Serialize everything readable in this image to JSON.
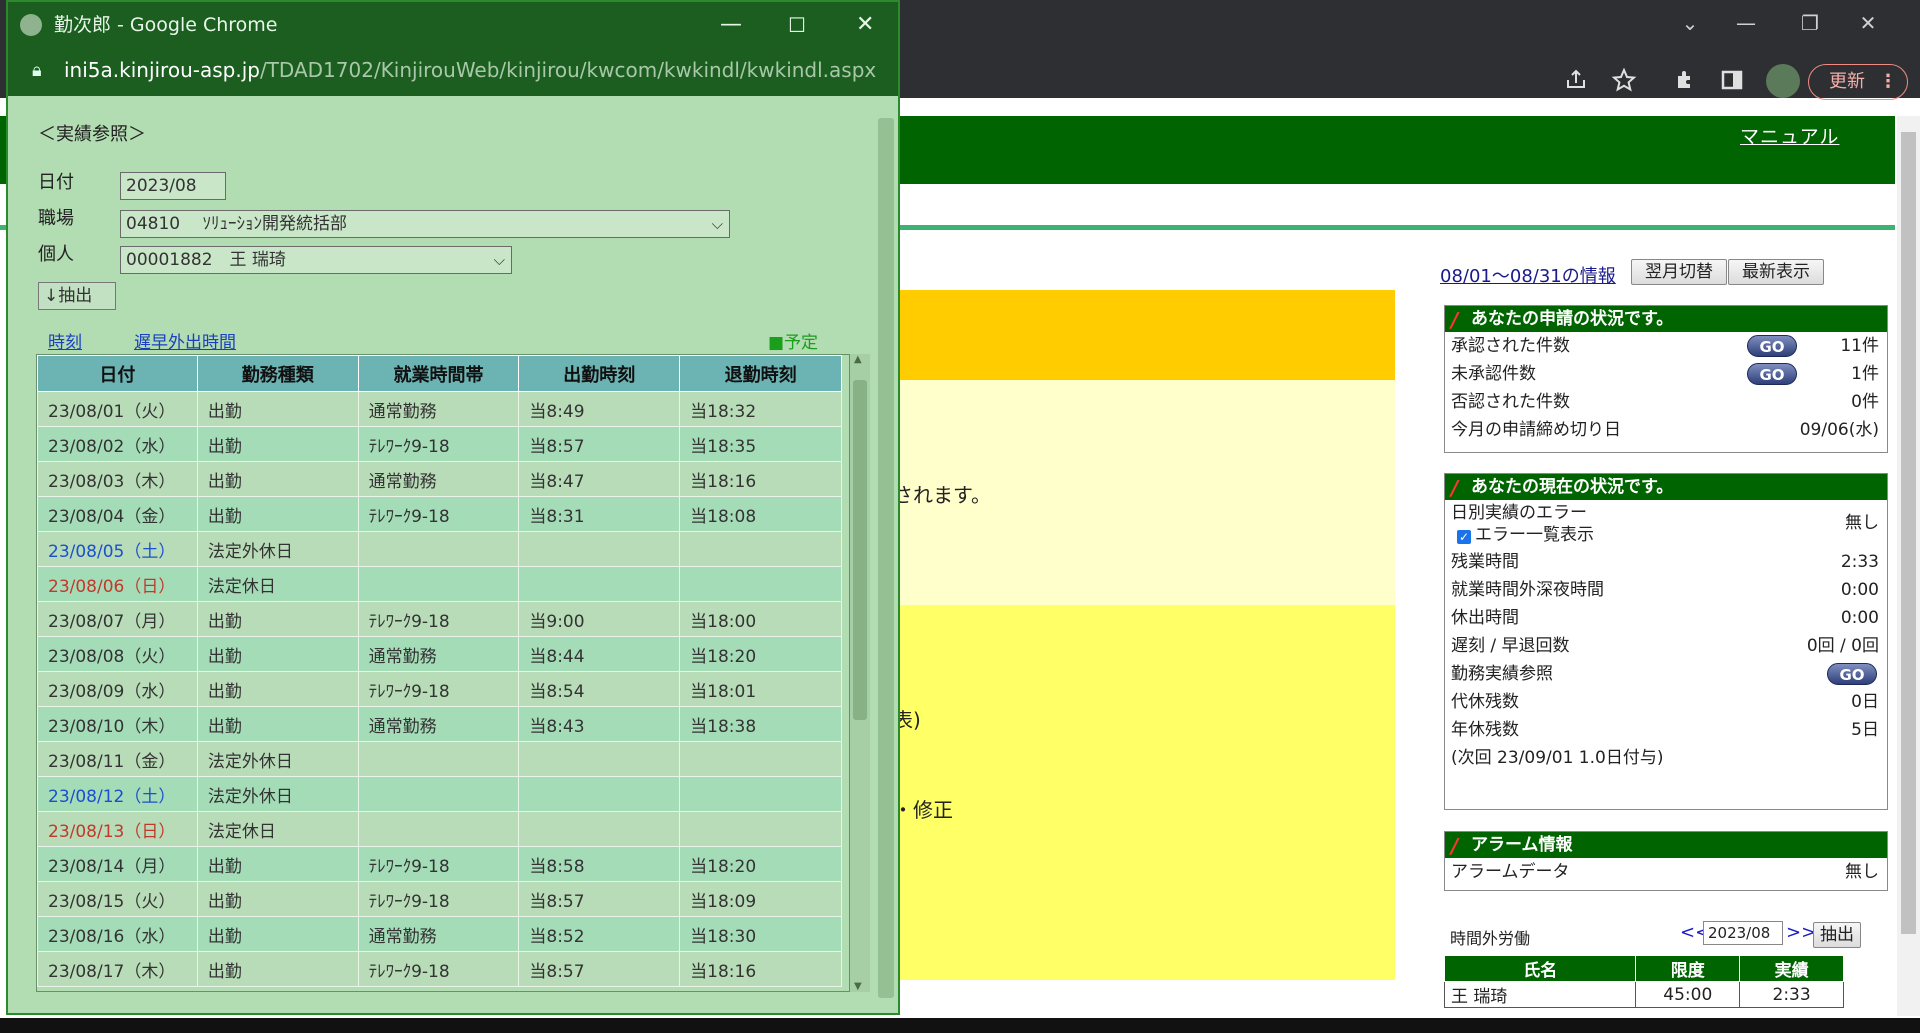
{
  "popup": {
    "window_title": "勤次郎 - Google Chrome",
    "url_host": "ini5a.kinjirou-asp.jp",
    "url_path": "/TDAD1702/KinjirouWeb/kinjirou/kwcom/kwkindl/kwkindl.aspx",
    "heading": "＜実績参照＞",
    "date_label": "日付",
    "date_value": "2023/08",
    "workplace_label": "職場",
    "workplace_value": "04810　 ｿﾘｭｰｼｮﾝ開発統括部",
    "person_label": "個人",
    "person_value": "00001882　王 瑞琦",
    "extract_button": "↓抽出",
    "link_time": "時刻",
    "link_late": "遅早外出時間",
    "legend": "■予定",
    "columns": [
      "日付",
      "勤務種類",
      "就業時間帯",
      "出勤時刻",
      "退勤時刻"
    ],
    "rows": [
      {
        "date": "23/08/01（火）",
        "type": "出勤",
        "band": "通常勤務",
        "in": "当8:49",
        "out": "当18:32",
        "day": ""
      },
      {
        "date": "23/08/02（水）",
        "type": "出勤",
        "band": "ﾃﾚﾜｰｸ9-18",
        "in": "当8:57",
        "out": "当18:35",
        "day": ""
      },
      {
        "date": "23/08/03（木）",
        "type": "出勤",
        "band": "通常勤務",
        "in": "当8:47",
        "out": "当18:16",
        "day": ""
      },
      {
        "date": "23/08/04（金）",
        "type": "出勤",
        "band": "ﾃﾚﾜｰｸ9-18",
        "in": "当8:31",
        "out": "当18:08",
        "day": ""
      },
      {
        "date": "23/08/05（土）",
        "type": "法定外休日",
        "band": "",
        "in": "",
        "out": "",
        "day": "sat"
      },
      {
        "date": "23/08/06（日）",
        "type": "法定休日",
        "band": "",
        "in": "",
        "out": "",
        "day": "sun"
      },
      {
        "date": "23/08/07（月）",
        "type": "出勤",
        "band": "ﾃﾚﾜｰｸ9-18",
        "in": "当9:00",
        "out": "当18:00",
        "day": ""
      },
      {
        "date": "23/08/08（火）",
        "type": "出勤",
        "band": "通常勤務",
        "in": "当8:44",
        "out": "当18:20",
        "day": ""
      },
      {
        "date": "23/08/09（水）",
        "type": "出勤",
        "band": "ﾃﾚﾜｰｸ9-18",
        "in": "当8:54",
        "out": "当18:01",
        "day": ""
      },
      {
        "date": "23/08/10（木）",
        "type": "出勤",
        "band": "通常勤務",
        "in": "当8:43",
        "out": "当18:38",
        "day": ""
      },
      {
        "date": "23/08/11（金）",
        "type": "法定外休日",
        "band": "",
        "in": "",
        "out": "",
        "day": ""
      },
      {
        "date": "23/08/12（土）",
        "type": "法定外休日",
        "band": "",
        "in": "",
        "out": "",
        "day": "sat"
      },
      {
        "date": "23/08/13（日）",
        "type": "法定休日",
        "band": "",
        "in": "",
        "out": "",
        "day": "sun"
      },
      {
        "date": "23/08/14（月）",
        "type": "出勤",
        "band": "ﾃﾚﾜｰｸ9-18",
        "in": "当8:58",
        "out": "当18:20",
        "day": ""
      },
      {
        "date": "23/08/15（火）",
        "type": "出勤",
        "band": "ﾃﾚﾜｰｸ9-18",
        "in": "当8:57",
        "out": "当18:09",
        "day": ""
      },
      {
        "date": "23/08/16（水）",
        "type": "出勤",
        "band": "通常勤務",
        "in": "当8:52",
        "out": "当18:30",
        "day": ""
      },
      {
        "date": "23/08/17（木）",
        "type": "出勤",
        "band": "ﾃﾚﾜｰｸ9-18",
        "in": "当8:57",
        "out": "当18:16",
        "day": ""
      }
    ]
  },
  "browser": {
    "update_button": "更新"
  },
  "page": {
    "manual_link": "マニュアル",
    "fragment_1": "されます。",
    "fragment_2": "表)",
    "fragment_3": "・修正",
    "period_link": "08/01～08/31の情報",
    "next_month_button": "翌月切替",
    "refresh_button": "最新表示",
    "requests": {
      "title": "あなたの申請の状況です。",
      "approved_label": "承認された件数",
      "approved_value": "11件",
      "pending_label": "未承認件数",
      "pending_value": "1件",
      "rejected_label": "否認された件数",
      "rejected_value": "0件",
      "deadline_label": "今月の申請締め切り日",
      "deadline_value": "09/06(水)",
      "go": "GO"
    },
    "status": {
      "title": "あなたの現在の状況です。",
      "error_label": "日別実績のエラー",
      "error_value": "無し",
      "error_list_label": "エラー一覧表示",
      "overtime_label": "残業時間",
      "overtime_value": "2:33",
      "night_label": "就業時間外深夜時間",
      "night_value": "0:00",
      "holiday_label": "休出時間",
      "holiday_value": "0:00",
      "late_label": "遅刻 / 早退回数",
      "late_value": "0回 / 0回",
      "actual_label": "勤務実績参照",
      "comp_label": "代休残数",
      "comp_value": "0日",
      "annual_label": "年休残数",
      "annual_value": "5日",
      "next_grant": "(次回 23/09/01 1.0日付与)",
      "go": "GO"
    },
    "alarm": {
      "title": "アラーム情報",
      "data_label": "アラームデータ",
      "data_value": "無し"
    },
    "overtime_work": {
      "title": "時間外労働",
      "prev": "<<",
      "month": "2023/08",
      "next": ">>",
      "extract": "抽出",
      "columns": [
        "氏名",
        "限度",
        "実績"
      ],
      "name": "王 瑞琦",
      "limit": "45:00",
      "actual": "2:33"
    }
  }
}
